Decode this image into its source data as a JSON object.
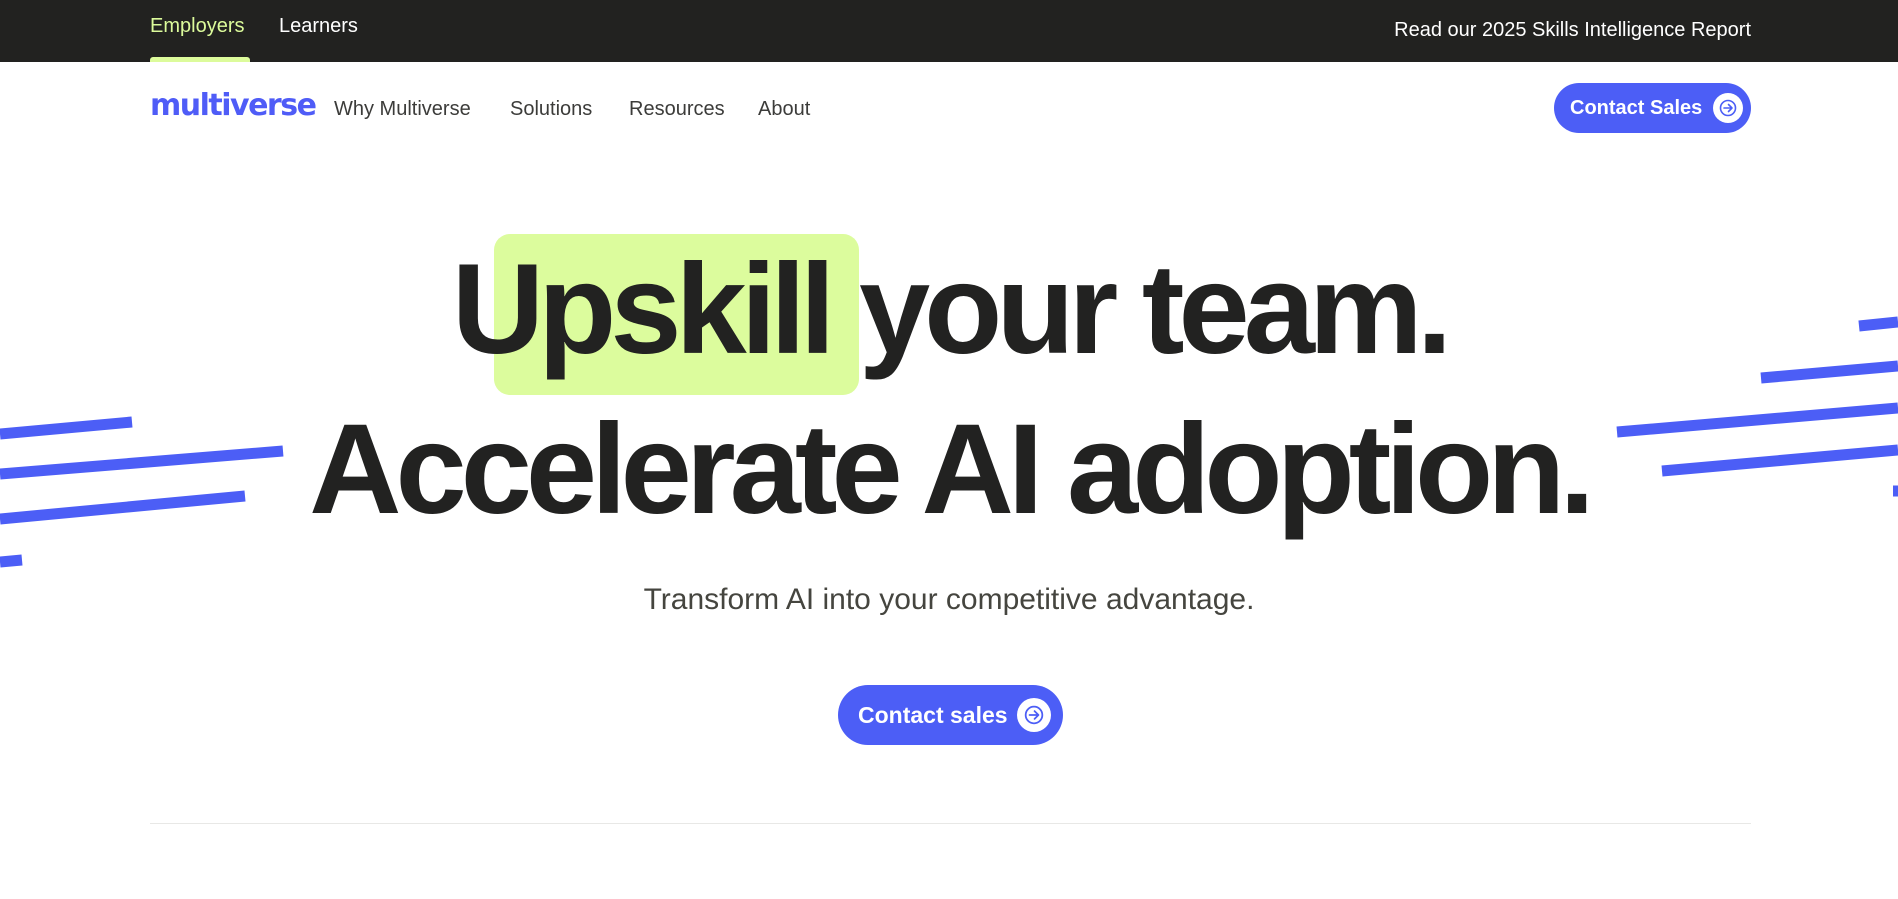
{
  "topbar": {
    "tabs": [
      {
        "label": "Employers",
        "active": true
      },
      {
        "label": "Learners",
        "active": false
      }
    ],
    "report_link": "Read our 2025 Skills Intelligence Report"
  },
  "nav": {
    "logo": "multiverse",
    "items": [
      {
        "label": "Why Multiverse"
      },
      {
        "label": "Solutions"
      },
      {
        "label": "Resources"
      },
      {
        "label": "About"
      }
    ],
    "cta": "Contact Sales",
    "cta_icon": "arrow-right-icon"
  },
  "hero": {
    "highlight_word": "Upskill",
    "line1_rest": "your team.",
    "line2": "Accelerate AI adoption.",
    "subtitle": "Transform AI into your competitive advantage.",
    "cta": "Contact sales",
    "cta_icon": "arrow-right-icon"
  },
  "colors": {
    "brand_blue": "#4c5ef6",
    "highlight_green": "#dcfc9d",
    "topbar_bg": "#222220",
    "text_dark": "#222221"
  }
}
